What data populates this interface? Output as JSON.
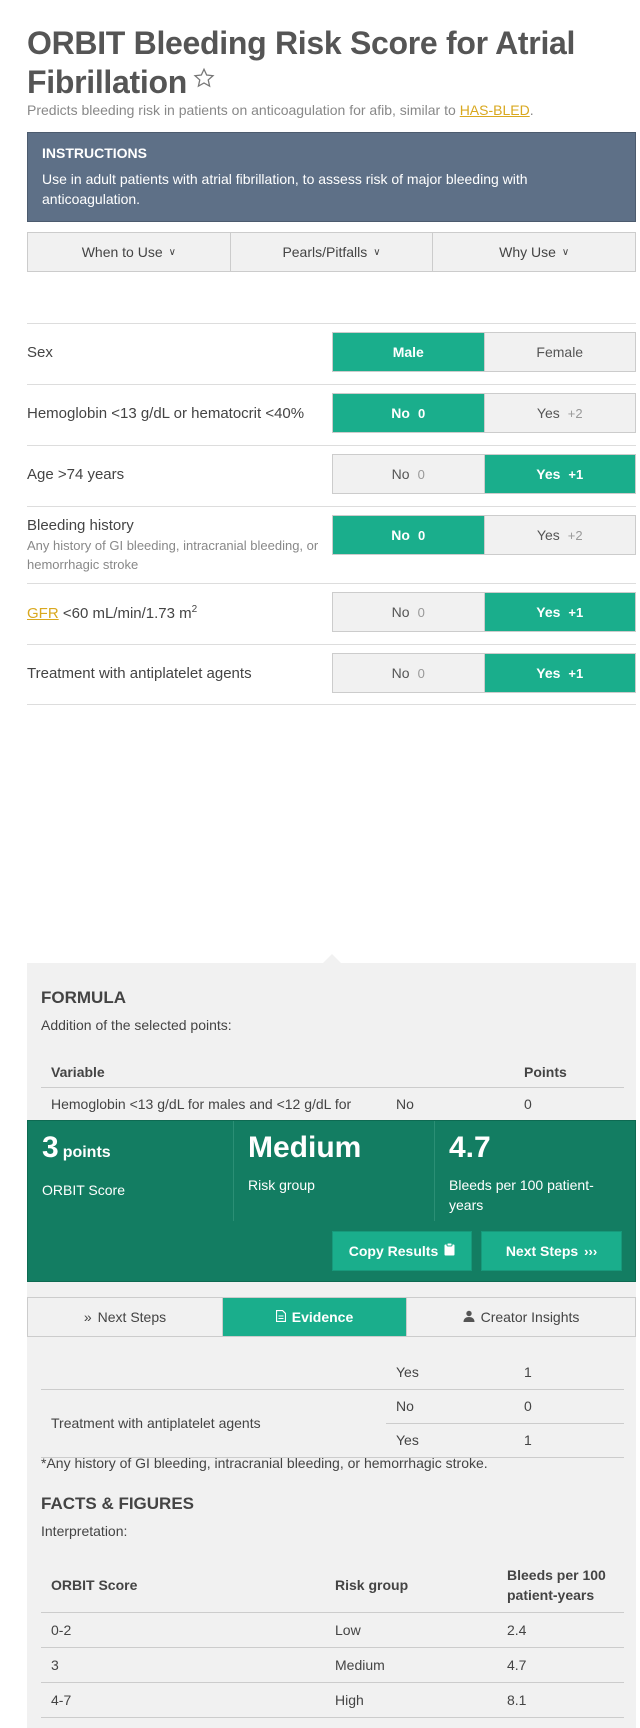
{
  "header": {
    "title": "ORBIT Bleeding Risk Score for Atrial Fibrillation",
    "subtitle_prefix": "Predicts bleeding risk in patients on anticoagulation for afib, similar to ",
    "subtitle_link": "HAS-BLED",
    "subtitle_suffix": "."
  },
  "instructions": {
    "heading": "INSTRUCTIONS",
    "body": "Use in adult patients with atrial fibrillation, to assess risk of major bleeding with anticoagulation."
  },
  "info_tabs": [
    "When to Use",
    "Pearls/Pitfalls",
    "Why Use"
  ],
  "inputs": [
    {
      "label": "Sex",
      "sub": "",
      "link": "",
      "options": [
        {
          "text": "Male",
          "pts": ""
        },
        {
          "text": "Female",
          "pts": ""
        }
      ],
      "selected": 0
    },
    {
      "label": "Hemoglobin <13 g/dL or hematocrit <40%",
      "sub": "",
      "link": "",
      "options": [
        {
          "text": "No",
          "pts": "0"
        },
        {
          "text": "Yes",
          "pts": "+2"
        }
      ],
      "selected": 0
    },
    {
      "label": "Age >74 years",
      "sub": "",
      "link": "",
      "options": [
        {
          "text": "No",
          "pts": "0"
        },
        {
          "text": "Yes",
          "pts": "+1"
        }
      ],
      "selected": 1
    },
    {
      "label": "Bleeding history",
      "sub": "Any history of GI bleeding, intracranial bleeding, or hemorrhagic stroke",
      "link": "",
      "options": [
        {
          "text": "No",
          "pts": "0"
        },
        {
          "text": "Yes",
          "pts": "+2"
        }
      ],
      "selected": 0
    },
    {
      "label": " <60 mL/min/1.73 m",
      "sup": "2",
      "sub": "",
      "link": "GFR",
      "options": [
        {
          "text": "No",
          "pts": "0"
        },
        {
          "text": "Yes",
          "pts": "+1"
        }
      ],
      "selected": 1
    },
    {
      "label": "Treatment with antiplatelet agents",
      "sub": "",
      "link": "",
      "options": [
        {
          "text": "No",
          "pts": "0"
        },
        {
          "text": "Yes",
          "pts": "+1"
        }
      ],
      "selected": 1
    }
  ],
  "formula": {
    "heading": "FORMULA",
    "text": "Addition of the selected points:",
    "col_variable": "Variable",
    "col_points": "Points",
    "first_row": {
      "variable": "Hemoglobin <13 g/dL for males and <12 g/dL for",
      "answer": "No",
      "points": "0"
    },
    "partial_row": {
      "answer": "Yes",
      "points": "1"
    },
    "antiplatelet": {
      "variable": "Treatment with antiplatelet agents",
      "no": "No",
      "no_pts": "0",
      "yes": "Yes",
      "yes_pts": "1"
    },
    "footnote": "*Any history of GI bleeding, intracranial bleeding, or hemorrhagic stroke."
  },
  "facts": {
    "heading": "FACTS & FIGURES",
    "text": "Interpretation:",
    "headers": [
      "ORBIT Score",
      "Risk group",
      "Bleeds per 100 patient-years"
    ],
    "rows": [
      [
        "0-2",
        "Low",
        "2.4"
      ],
      [
        "3",
        "Medium",
        "4.7"
      ],
      [
        "4-7",
        "High",
        "8.1"
      ]
    ]
  },
  "result": {
    "score_value": "3",
    "score_unit": "points",
    "score_label": "ORBIT Score",
    "risk_value": "Medium",
    "risk_label": "Risk group",
    "bleeds_value": "4.7",
    "bleeds_label": "Bleeds per 100 patient-years",
    "copy_button": "Copy Results",
    "next_button": "Next Steps"
  },
  "bottom_tabs": {
    "next_steps": "Next Steps",
    "evidence": "Evidence",
    "creator": "Creator Insights",
    "active": "Evidence"
  },
  "colors": {
    "accent": "#1aae8c",
    "result_bg": "#137d62",
    "instructions_bg": "#5e7087",
    "link": "#d9a81f"
  }
}
